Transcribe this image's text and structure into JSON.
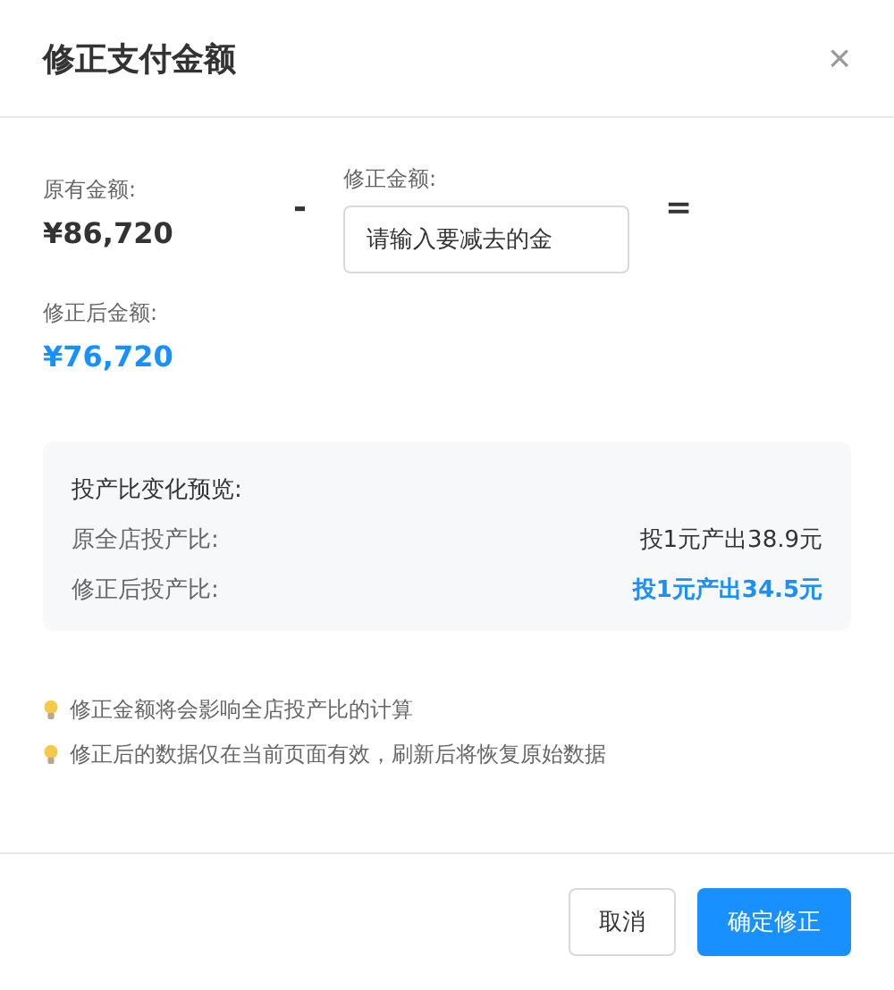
{
  "dialog": {
    "title": "修正支付金额",
    "close": "×"
  },
  "original": {
    "label": "原有金额:",
    "value": "¥86,720"
  },
  "operator_minus": "-",
  "adjust": {
    "label": "修正金额:",
    "placeholder": "请输入要减去的金"
  },
  "operator_equals": "=",
  "result": {
    "label": "修正后金额:",
    "value": "¥76,720"
  },
  "preview": {
    "title": "投产比变化预览:",
    "rows": [
      {
        "label": "原全店投产比:",
        "value": "投1元产出38.9元",
        "emphasis": false
      },
      {
        "label": "修正后投产比:",
        "value": "投1元产出34.5元",
        "emphasis": true
      }
    ]
  },
  "tips": [
    "修正金额将会影响全店投产比的计算",
    "修正后的数据仅在当前页面有效，刷新后将恢复原始数据"
  ],
  "buttons": [
    {
      "label": "取消",
      "kind": "secondary"
    },
    {
      "label": "确定修正",
      "kind": "primary"
    }
  ]
}
